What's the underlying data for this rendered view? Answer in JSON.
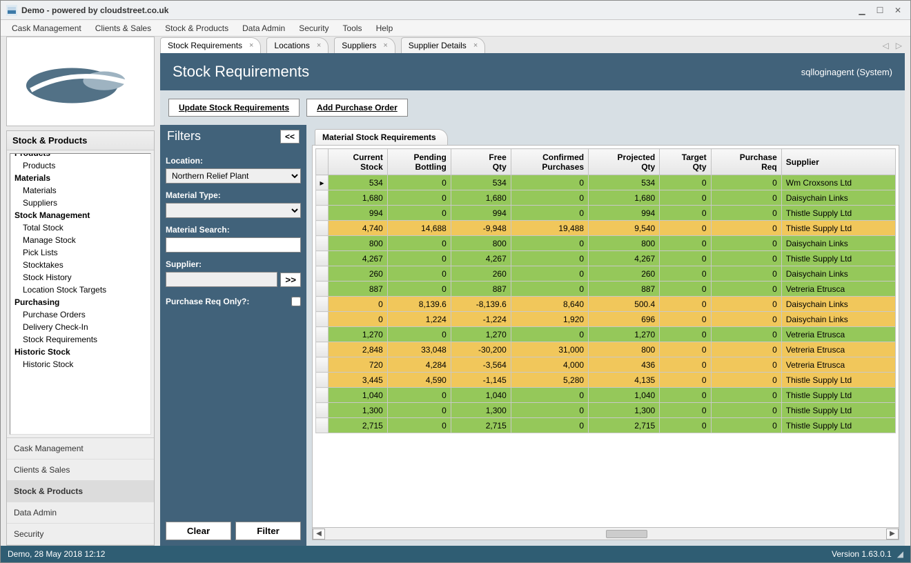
{
  "window_title": "Demo - powered by cloudstreet.co.uk",
  "menubar": [
    "Cask Management",
    "Clients & Sales",
    "Stock & Products",
    "Data Admin",
    "Security",
    "Tools",
    "Help"
  ],
  "tabs": [
    {
      "label": "Stock Requirements",
      "active": true
    },
    {
      "label": "Locations"
    },
    {
      "label": "Suppliers"
    },
    {
      "label": "Supplier Details"
    }
  ],
  "page_title": "Stock Requirements",
  "user_label": "sqlloginagent (System)",
  "actions": {
    "update": "Update Stock Requirements",
    "add": "Add Purchase Order"
  },
  "sidebar": {
    "section_title": "Stock & Products",
    "tree": [
      {
        "type": "cat",
        "label": "Products",
        "cut": true
      },
      {
        "type": "item",
        "label": "Products"
      },
      {
        "type": "cat",
        "label": "Materials"
      },
      {
        "type": "item",
        "label": "Materials"
      },
      {
        "type": "item",
        "label": "Suppliers"
      },
      {
        "type": "cat",
        "label": "Stock Management"
      },
      {
        "type": "item",
        "label": "Total Stock"
      },
      {
        "type": "item",
        "label": "Manage Stock"
      },
      {
        "type": "item",
        "label": "Pick Lists"
      },
      {
        "type": "item",
        "label": "Stocktakes"
      },
      {
        "type": "item",
        "label": "Stock History"
      },
      {
        "type": "item",
        "label": "Location Stock Targets"
      },
      {
        "type": "cat",
        "label": "Purchasing"
      },
      {
        "type": "item",
        "label": "Purchase Orders"
      },
      {
        "type": "item",
        "label": "Delivery Check-In"
      },
      {
        "type": "item",
        "label": "Stock Requirements"
      },
      {
        "type": "cat",
        "label": "Historic Stock"
      },
      {
        "type": "item",
        "label": "Historic Stock"
      }
    ],
    "cats": [
      "Cask Management",
      "Clients & Sales",
      "Stock & Products",
      "Data Admin",
      "Security"
    ]
  },
  "filters": {
    "title": "Filters",
    "collapse": "<<",
    "location_label": "Location:",
    "location_value": "Northern Relief Plant",
    "mtype_label": "Material Type:",
    "mtype_value": "",
    "msearch_label": "Material Search:",
    "msearch_value": "",
    "supplier_label": "Supplier:",
    "supplier_value": "",
    "supplier_open": ">>",
    "preq_label": "Purchase Req Only?:",
    "clear": "Clear",
    "filter": "Filter"
  },
  "grid": {
    "tab": "Material Stock Requirements",
    "columns": [
      "Current Stock",
      "Pending Bottling",
      "Free Qty",
      "Confirmed Purchases",
      "Projected Qty",
      "Target Qty",
      "Purchase Req",
      "Supplier"
    ],
    "rows": [
      {
        "c": "g",
        "cs": "534",
        "pb": "0",
        "fq": "534",
        "cp": "0",
        "pq": "534",
        "tq": "0",
        "pr": "0",
        "sup": "Wm Croxsons Ltd",
        "sel": true
      },
      {
        "c": "g",
        "cs": "1,680",
        "pb": "0",
        "fq": "1,680",
        "cp": "0",
        "pq": "1,680",
        "tq": "0",
        "pr": "0",
        "sup": "Daisychain Links"
      },
      {
        "c": "g",
        "cs": "994",
        "pb": "0",
        "fq": "994",
        "cp": "0",
        "pq": "994",
        "tq": "0",
        "pr": "0",
        "sup": "Thistle Supply Ltd"
      },
      {
        "c": "y",
        "cs": "4,740",
        "pb": "14,688",
        "fq": "-9,948",
        "cp": "19,488",
        "pq": "9,540",
        "tq": "0",
        "pr": "0",
        "sup": "Thistle Supply Ltd"
      },
      {
        "c": "g",
        "cs": "800",
        "pb": "0",
        "fq": "800",
        "cp": "0",
        "pq": "800",
        "tq": "0",
        "pr": "0",
        "sup": "Daisychain Links"
      },
      {
        "c": "g",
        "cs": "4,267",
        "pb": "0",
        "fq": "4,267",
        "cp": "0",
        "pq": "4,267",
        "tq": "0",
        "pr": "0",
        "sup": "Thistle Supply Ltd"
      },
      {
        "c": "g",
        "cs": "260",
        "pb": "0",
        "fq": "260",
        "cp": "0",
        "pq": "260",
        "tq": "0",
        "pr": "0",
        "sup": "Daisychain Links"
      },
      {
        "c": "g",
        "cs": "887",
        "pb": "0",
        "fq": "887",
        "cp": "0",
        "pq": "887",
        "tq": "0",
        "pr": "0",
        "sup": "Vetreria Etrusca"
      },
      {
        "c": "y",
        "cs": "0",
        "pb": "8,139.6",
        "fq": "-8,139.6",
        "cp": "8,640",
        "pq": "500.4",
        "tq": "0",
        "pr": "0",
        "sup": "Daisychain Links"
      },
      {
        "c": "y",
        "cs": "0",
        "pb": "1,224",
        "fq": "-1,224",
        "cp": "1,920",
        "pq": "696",
        "tq": "0",
        "pr": "0",
        "sup": "Daisychain Links"
      },
      {
        "c": "g",
        "cs": "1,270",
        "pb": "0",
        "fq": "1,270",
        "cp": "0",
        "pq": "1,270",
        "tq": "0",
        "pr": "0",
        "sup": "Vetreria Etrusca"
      },
      {
        "c": "y",
        "cs": "2,848",
        "pb": "33,048",
        "fq": "-30,200",
        "cp": "31,000",
        "pq": "800",
        "tq": "0",
        "pr": "0",
        "sup": "Vetreria Etrusca"
      },
      {
        "c": "y",
        "cs": "720",
        "pb": "4,284",
        "fq": "-3,564",
        "cp": "4,000",
        "pq": "436",
        "tq": "0",
        "pr": "0",
        "sup": "Vetreria Etrusca"
      },
      {
        "c": "y",
        "cs": "3,445",
        "pb": "4,590",
        "fq": "-1,145",
        "cp": "5,280",
        "pq": "4,135",
        "tq": "0",
        "pr": "0",
        "sup": "Thistle Supply Ltd"
      },
      {
        "c": "g",
        "cs": "1,040",
        "pb": "0",
        "fq": "1,040",
        "cp": "0",
        "pq": "1,040",
        "tq": "0",
        "pr": "0",
        "sup": "Thistle Supply Ltd"
      },
      {
        "c": "g",
        "cs": "1,300",
        "pb": "0",
        "fq": "1,300",
        "cp": "0",
        "pq": "1,300",
        "tq": "0",
        "pr": "0",
        "sup": "Thistle Supply Ltd"
      },
      {
        "c": "g",
        "cs": "2,715",
        "pb": "0",
        "fq": "2,715",
        "cp": "0",
        "pq": "2,715",
        "tq": "0",
        "pr": "0",
        "sup": "Thistle Supply Ltd"
      }
    ]
  },
  "status": {
    "left": "Demo, 28 May 2018 12:12",
    "version": "Version 1.63.0.1"
  }
}
